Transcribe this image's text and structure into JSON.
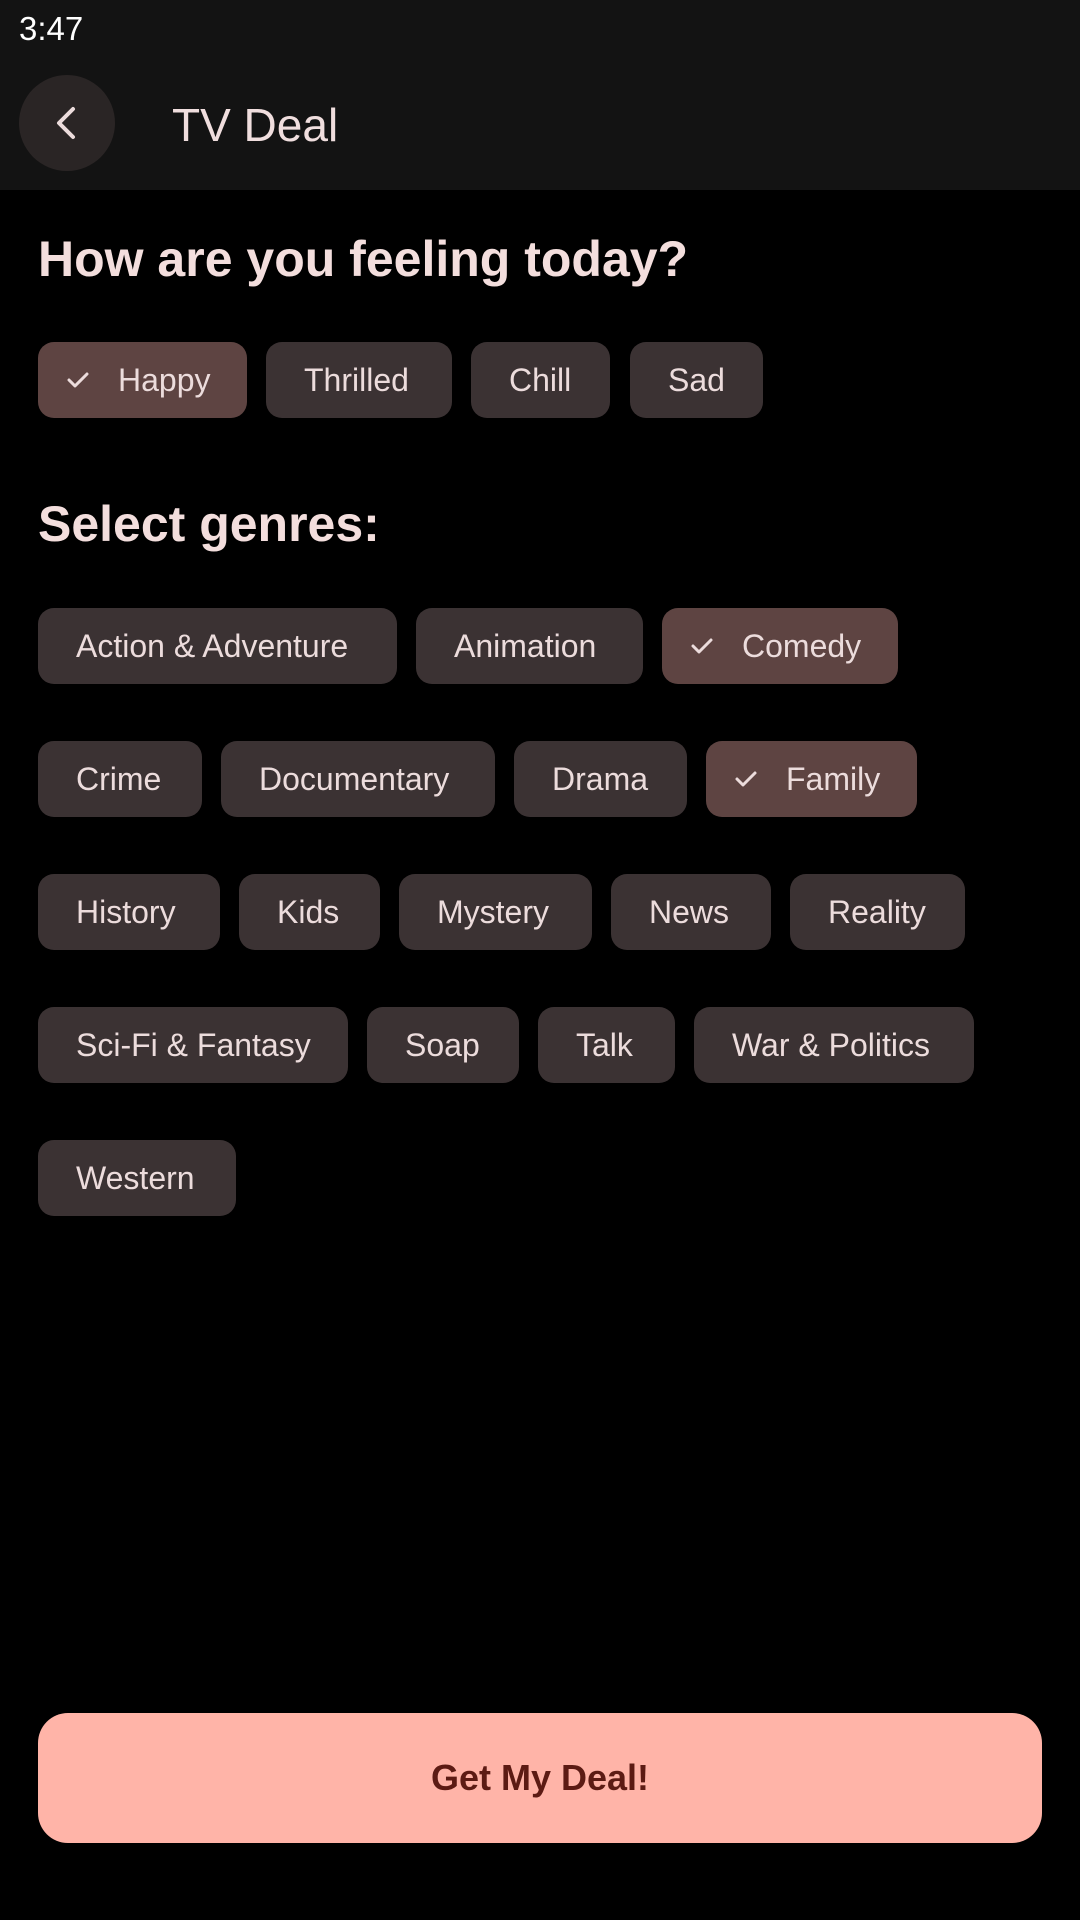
{
  "status_bar": {
    "time": "3:47"
  },
  "app_bar": {
    "title": "TV Deal",
    "back_icon": "arrow-back-icon"
  },
  "mood": {
    "heading": "How are you feeling today?",
    "options": [
      {
        "label": "Happy",
        "selected": true
      },
      {
        "label": "Thrilled",
        "selected": false
      },
      {
        "label": "Chill",
        "selected": false
      },
      {
        "label": "Sad",
        "selected": false
      }
    ]
  },
  "genres": {
    "heading": "Select genres:",
    "options": [
      {
        "label": "Action & Adventure",
        "selected": false
      },
      {
        "label": "Animation",
        "selected": false
      },
      {
        "label": "Comedy",
        "selected": true
      },
      {
        "label": "Crime",
        "selected": false
      },
      {
        "label": "Documentary",
        "selected": false
      },
      {
        "label": "Drama",
        "selected": false
      },
      {
        "label": "Family",
        "selected": true
      },
      {
        "label": "History",
        "selected": false
      },
      {
        "label": "Kids",
        "selected": false
      },
      {
        "label": "Mystery",
        "selected": false
      },
      {
        "label": "News",
        "selected": false
      },
      {
        "label": "Reality",
        "selected": false
      },
      {
        "label": "Sci-Fi & Fantasy",
        "selected": false
      },
      {
        "label": "Soap",
        "selected": false
      },
      {
        "label": "Talk",
        "selected": false
      },
      {
        "label": "War & Politics",
        "selected": false
      },
      {
        "label": "Western",
        "selected": false
      }
    ]
  },
  "cta": {
    "label": "Get My Deal!"
  },
  "colors": {
    "background": "#000000",
    "app_bar": "#131313",
    "chip": "#3b3233",
    "chip_selected": "#5e4442",
    "chip_text": "#ecdcdc",
    "cta_background": "#ffb4a8",
    "cta_text": "#5c1b14"
  }
}
